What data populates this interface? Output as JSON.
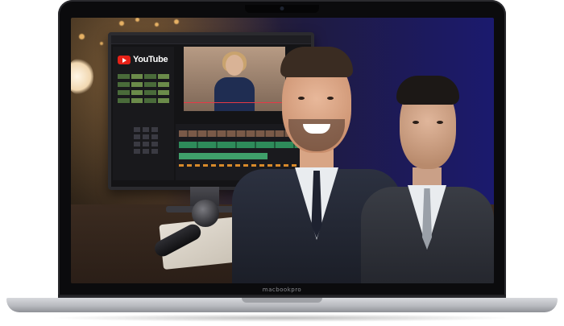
{
  "laptop": {
    "bezel_label": "macbookpro"
  },
  "screen": {
    "monitor_app": {
      "logo_text": "YouTube",
      "logo_color": "#e62117"
    },
    "background_colors": {
      "left": "#3a2a1e",
      "right": "#1b1a6e"
    }
  }
}
